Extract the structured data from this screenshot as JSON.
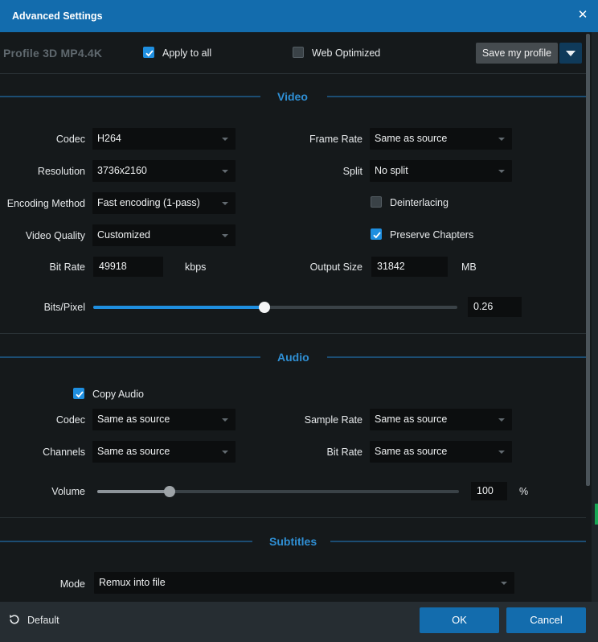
{
  "window": {
    "title": "Advanced Settings"
  },
  "profile": {
    "label": "Profile",
    "name": "3D MP4.4K",
    "apply_to_all": {
      "label": "Apply to all",
      "checked": true
    },
    "web_optimized": {
      "label": "Web Optimized",
      "checked": false
    },
    "save_label": "Save my profile"
  },
  "video": {
    "section_title": "Video",
    "codec": {
      "label": "Codec",
      "value": "H264"
    },
    "frame_rate": {
      "label": "Frame Rate",
      "value": "Same as source"
    },
    "resolution": {
      "label": "Resolution",
      "value": "3736x2160"
    },
    "split": {
      "label": "Split",
      "value": "No split"
    },
    "encoding_method": {
      "label": "Encoding Method",
      "value": "Fast encoding (1-pass)"
    },
    "deinterlacing": {
      "label": "Deinterlacing",
      "checked": false
    },
    "video_quality": {
      "label": "Video Quality",
      "value": "Customized"
    },
    "preserve_chapters": {
      "label": "Preserve Chapters",
      "checked": true
    },
    "bit_rate": {
      "label": "Bit Rate",
      "value": "49918",
      "unit": "kbps"
    },
    "output_size": {
      "label": "Output Size",
      "value": "31842",
      "unit": "MB"
    },
    "bits_pixel": {
      "label": "Bits/Pixel",
      "value": "0.26",
      "slider_fraction": 0.47
    }
  },
  "audio": {
    "section_title": "Audio",
    "copy_audio": {
      "label": "Copy Audio",
      "checked": true
    },
    "codec": {
      "label": "Codec",
      "value": "Same as source"
    },
    "sample_rate": {
      "label": "Sample Rate",
      "value": "Same as source"
    },
    "channels": {
      "label": "Channels",
      "value": "Same as source"
    },
    "bit_rate": {
      "label": "Bit Rate",
      "value": "Same as source"
    },
    "volume": {
      "label": "Volume",
      "value": "100",
      "unit": "%",
      "slider_fraction": 0.2
    }
  },
  "subtitles": {
    "section_title": "Subtitles",
    "mode": {
      "label": "Mode",
      "value": "Remux into file"
    }
  },
  "footer": {
    "default_label": "Default",
    "ok_label": "OK",
    "cancel_label": "Cancel"
  },
  "colors": {
    "accent": "#136cad",
    "checkbox_checked": "#1f8fe0",
    "section_title": "#2f8fd4"
  },
  "icons": {
    "close": "close-icon",
    "dropdown": "chevron-down-icon",
    "checkmark": "checkmark-icon",
    "default": "reset-icon"
  }
}
